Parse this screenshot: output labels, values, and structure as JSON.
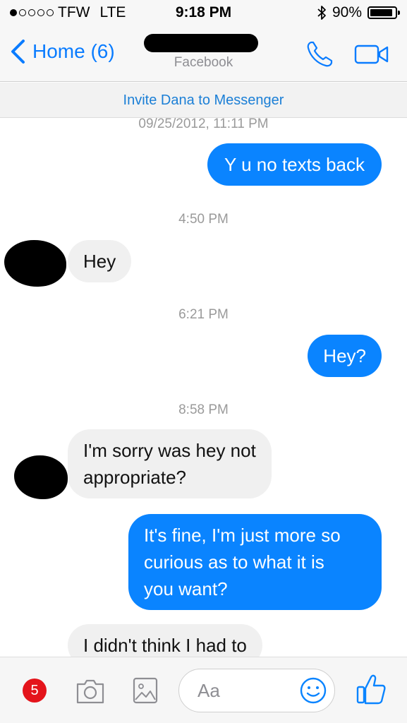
{
  "status_bar": {
    "signal_dots_filled": 1,
    "signal_dots_total": 5,
    "carrier": "TFW",
    "network": "LTE",
    "time": "9:18 PM",
    "battery_percent": "90%",
    "battery_level": 0.9,
    "bluetooth_icon": "bluetooth-icon"
  },
  "nav": {
    "back_label": "Home (6)",
    "subtitle": "Facebook",
    "phone_icon": "phone-icon",
    "video_icon": "video-camera-icon"
  },
  "invite": {
    "text": "Invite Dana to Messenger"
  },
  "conversation": {
    "timestamps": [
      "09/25/2012, 11:11 PM",
      "4:50 PM",
      "6:21 PM",
      "8:58 PM"
    ],
    "messages": [
      {
        "direction": "out",
        "lines": [
          "Y u no texts back"
        ]
      },
      {
        "direction": "in",
        "lines": [
          "Hey"
        ]
      },
      {
        "direction": "out",
        "lines": [
          "Hey?"
        ]
      },
      {
        "direction": "in",
        "lines": [
          "I'm sorry was hey not",
          "appropriate?"
        ]
      },
      {
        "direction": "out",
        "lines": [
          "It's fine, I'm just more so",
          "curious as to what it is",
          "you want?"
        ]
      },
      {
        "direction": "in",
        "lines": [
          "I didn't think I had to"
        ]
      }
    ]
  },
  "composer": {
    "badge_count": "5",
    "placeholder": "Aa",
    "icons": [
      "camera-icon",
      "image-icon",
      "emoji-icon",
      "like-icon"
    ]
  },
  "colors": {
    "accent": "#0a84ff",
    "link": "#1b7fd6",
    "incoming_bubble": "#f0f0f0",
    "badge": "#e4141b"
  }
}
